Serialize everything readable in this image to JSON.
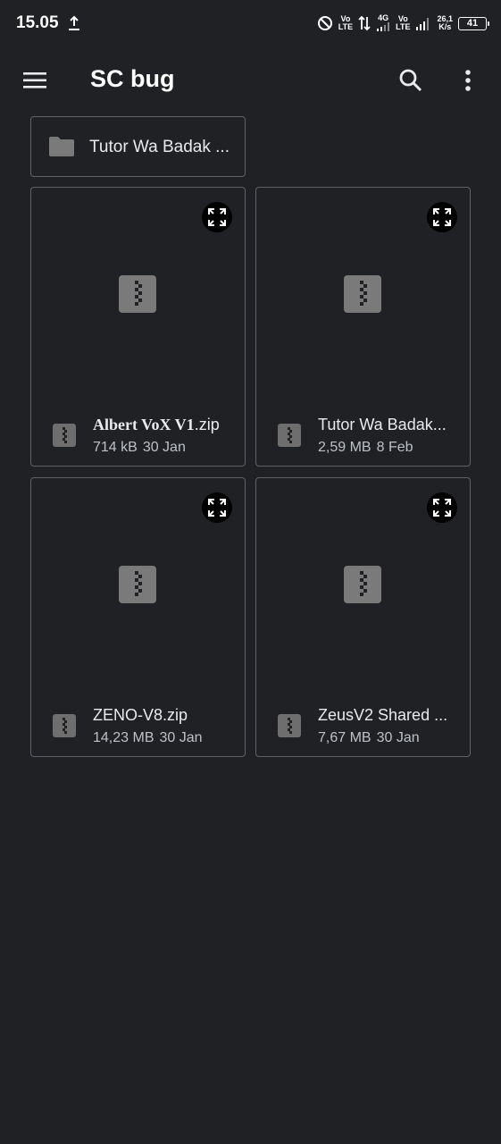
{
  "status_bar": {
    "time": "15.05",
    "volte1_top": "Vo",
    "volte1_bottom": "LTE",
    "network": "4G",
    "volte2_top": "Vo",
    "volte2_bottom": "LTE",
    "speed_value": "26,1",
    "speed_unit": "K/s",
    "battery": "41"
  },
  "app_bar": {
    "title": "SC bug",
    "menu_icon": "hamburger-menu-icon",
    "search_icon": "search-icon",
    "more_icon": "more-vert-icon"
  },
  "folders": [
    {
      "name": "Tutor Wa Badak ...",
      "icon": "folder-icon"
    }
  ],
  "files": [
    {
      "name_main": "Albert VoX V1",
      "name_ext": ".zip",
      "size": "714 kB",
      "date": "30 Jan",
      "icon": "zip-icon"
    },
    {
      "name_main": "Tutor Wa Badak...",
      "name_ext": "",
      "size": "2,59 MB",
      "date": "8 Feb",
      "icon": "zip-icon"
    },
    {
      "name_main": "ZENO-V8.zip",
      "name_ext": "",
      "size": "14,23 MB",
      "date": "30 Jan",
      "icon": "zip-icon"
    },
    {
      "name_main": "ZeusV2 Shared ...",
      "name_ext": "",
      "size": "7,67 MB",
      "date": "30 Jan",
      "icon": "zip-icon"
    }
  ],
  "colors": {
    "background": "#202124",
    "border": "#5f6368",
    "text": "#e8eaed"
  }
}
